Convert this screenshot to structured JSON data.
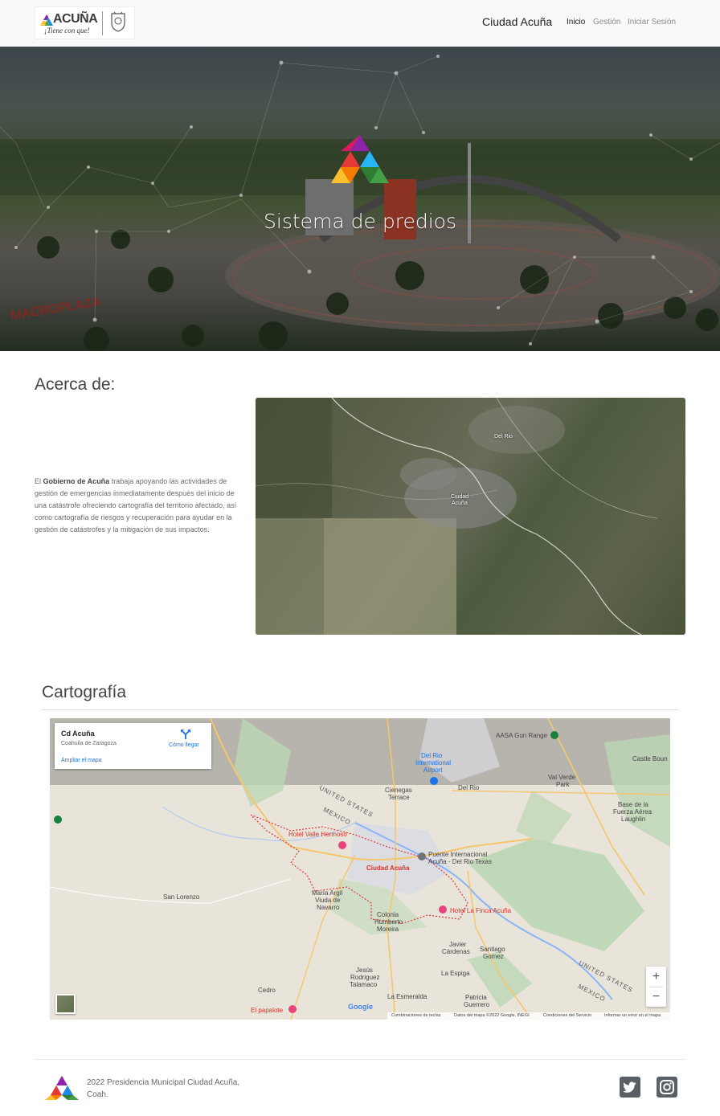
{
  "nav": {
    "logo_text": "ACUÑA",
    "logo_tagline": "¡Tiene con que!",
    "brand": "Ciudad Acuña",
    "links": [
      {
        "label": "Inicio",
        "active": true
      },
      {
        "label": "Gestión",
        "active": false
      },
      {
        "label": "Iniciar Sesión",
        "active": false
      }
    ]
  },
  "hero": {
    "title": "Sistema de predios",
    "watermark": "MACROPLAZA"
  },
  "about": {
    "title": "Acerca de:",
    "text_prefix": "El ",
    "text_bold": "Gobierno de Acuña",
    "text_rest": " trabaja apoyando las actividades de gestión de emergencias inmediatamente después del inicio de una catástrofe ofreciendo cartografía del territorio afectado, así como cartografía de riesgos y recuperación para ayudar en la gestión de catástrofes y la mitigación de sus impactos.",
    "satellite_labels": {
      "del_rio": "Del Rio",
      "ciudad_acuna_line1": "Ciudad",
      "ciudad_acuna_line2": "Acuña"
    }
  },
  "cartografia": {
    "title": "Cartografía",
    "card": {
      "place": "Cd Acuña",
      "region": "Coahuila de Zaragoza",
      "enlarge": "Ampliar el mapa",
      "directions": "Cómo llegar"
    },
    "map_labels": {
      "aasa": "AASA Gun Range",
      "castle": "Castle Boun",
      "del_rio_intl_1": "Del Rio",
      "del_rio_intl_2": "International",
      "del_rio_intl_3": "Airport",
      "val_verde_1": "Val Verde",
      "val_verde_2": "Park",
      "cienegas_1": "Cienegas",
      "cienegas_2": "Terrace",
      "del_rio": "Del Rio",
      "base_1": "Base de la",
      "base_2": "Fuerza Aérea",
      "base_3": "Laughlin",
      "united_states": "UNITED STATES",
      "mexico": "MEXICO",
      "hotel_valle": "Hotel Valle Hermoso",
      "puente_1": "Puente Internacional",
      "puente_2": "Acuña - Del Rio Texas",
      "ciudad_acuna": "Ciudad Acuña",
      "san_lorenzo": "San Lorenzo",
      "maria_1": "María Argil",
      "maria_2": "Viuda de",
      "maria_3": "Navarro",
      "colonia_1": "Colonia",
      "colonia_2": "Humberto",
      "colonia_3": "Moreira",
      "hotel_finca": "Hotel La Finca Acuña",
      "javier_1": "Javier",
      "javier_2": "Cárdenas",
      "santiago_1": "Santiago",
      "santiago_2": "Gomez",
      "jesus_1": "Jesús",
      "jesus_2": "Rodriguez",
      "jesus_3": "Talamaco",
      "la_esmeralda": "La Esmeralda",
      "la_espiga": "La Espiga",
      "patricia_1": "Patricia",
      "patricia_2": "Guerrero",
      "cedro": "Cedro",
      "el_papalote": "El papalote",
      "united_states_2": "UNITED STATES",
      "mexico_2": "MEXICO",
      "google": "Google"
    },
    "footer_items": [
      "Combinaciones de teclas",
      "Datos del mapa ©2022 Google, INEGI",
      "Condiciones del Servicio",
      "Informar un error en el mapa"
    ],
    "zoom_in": "+",
    "zoom_out": "−"
  },
  "footer": {
    "text": "2022 Presidencia Municipal Ciudad Acuña, Coah.",
    "social": [
      "twitter-icon",
      "instagram-icon"
    ]
  }
}
